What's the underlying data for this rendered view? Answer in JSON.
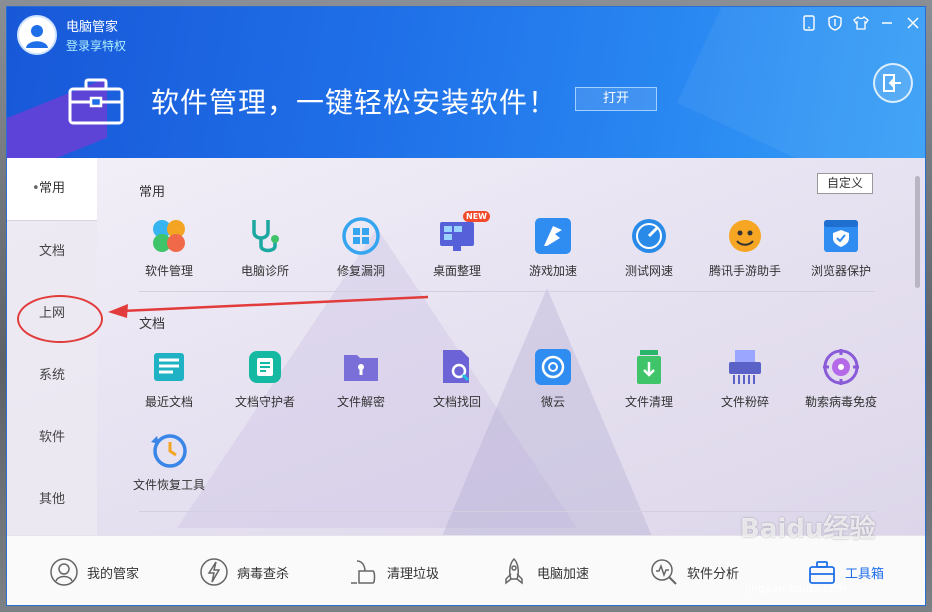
{
  "header": {
    "app_title": "电脑管家",
    "login_link": "登录享特权",
    "banner_text": "软件管理，一键轻松安装软件！",
    "open_label": "打开",
    "topbar_icons": [
      "phone-icon",
      "shield-icon",
      "shirt-icon",
      "minimize-icon",
      "close-icon"
    ]
  },
  "sidebar": {
    "items": [
      {
        "label": "常用"
      },
      {
        "label": "文档"
      },
      {
        "label": "上网"
      },
      {
        "label": "系统"
      },
      {
        "label": "软件"
      },
      {
        "label": "其他"
      }
    ]
  },
  "content": {
    "custom_label": "自定义",
    "sections": [
      {
        "title": "常用",
        "tiles": [
          {
            "label": "软件管理"
          },
          {
            "label": "电脑诊所"
          },
          {
            "label": "修复漏洞"
          },
          {
            "label": "桌面整理",
            "badge": "NEW"
          },
          {
            "label": "游戏加速"
          },
          {
            "label": "测试网速"
          },
          {
            "label": "腾讯手游助手"
          },
          {
            "label": "浏览器保护"
          }
        ]
      },
      {
        "title": "文档",
        "tiles": [
          {
            "label": "最近文档"
          },
          {
            "label": "文档守护者"
          },
          {
            "label": "文件解密"
          },
          {
            "label": "文档找回"
          },
          {
            "label": "微云"
          },
          {
            "label": "文件清理"
          },
          {
            "label": "文件粉碎"
          },
          {
            "label": "勒索病毒免疫"
          },
          {
            "label": "文件恢复工具"
          }
        ]
      }
    ]
  },
  "bottom_nav": [
    {
      "label": "我的管家"
    },
    {
      "label": "病毒查杀"
    },
    {
      "label": "清理垃圾"
    },
    {
      "label": "电脑加速"
    },
    {
      "label": "软件分析"
    },
    {
      "label": "工具箱"
    }
  ],
  "watermark": {
    "line1": "Baidu经验",
    "line2": "jingyan.baidu.com"
  },
  "colors": {
    "accent": "#1f6fe8",
    "annotation": "#e23b3b"
  }
}
